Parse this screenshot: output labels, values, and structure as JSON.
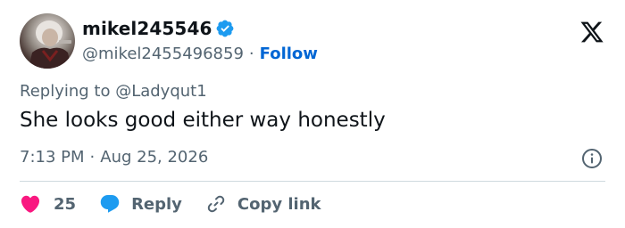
{
  "author": {
    "display_name": "mikel245546",
    "handle": "@mikel2455496859",
    "follow_label": "Follow",
    "verified": true
  },
  "header_separator": "·",
  "reply_to": "Replying to @Ladyqut1",
  "text": "She looks good either way honestly",
  "meta": {
    "time": "7:13 PM",
    "separator": "·",
    "date": "Aug 25, 2026"
  },
  "actions": {
    "like_count": "25",
    "reply_label": "Reply",
    "copy_link_label": "Copy link"
  },
  "colors": {
    "accent": "#1d9bf0",
    "follow": "#0066d4",
    "like": "#f91880",
    "muted": "#536471"
  },
  "icons": [
    "x-logo-icon",
    "verified-badge-icon",
    "info-icon",
    "heart-icon",
    "reply-bubble-icon",
    "link-icon"
  ]
}
